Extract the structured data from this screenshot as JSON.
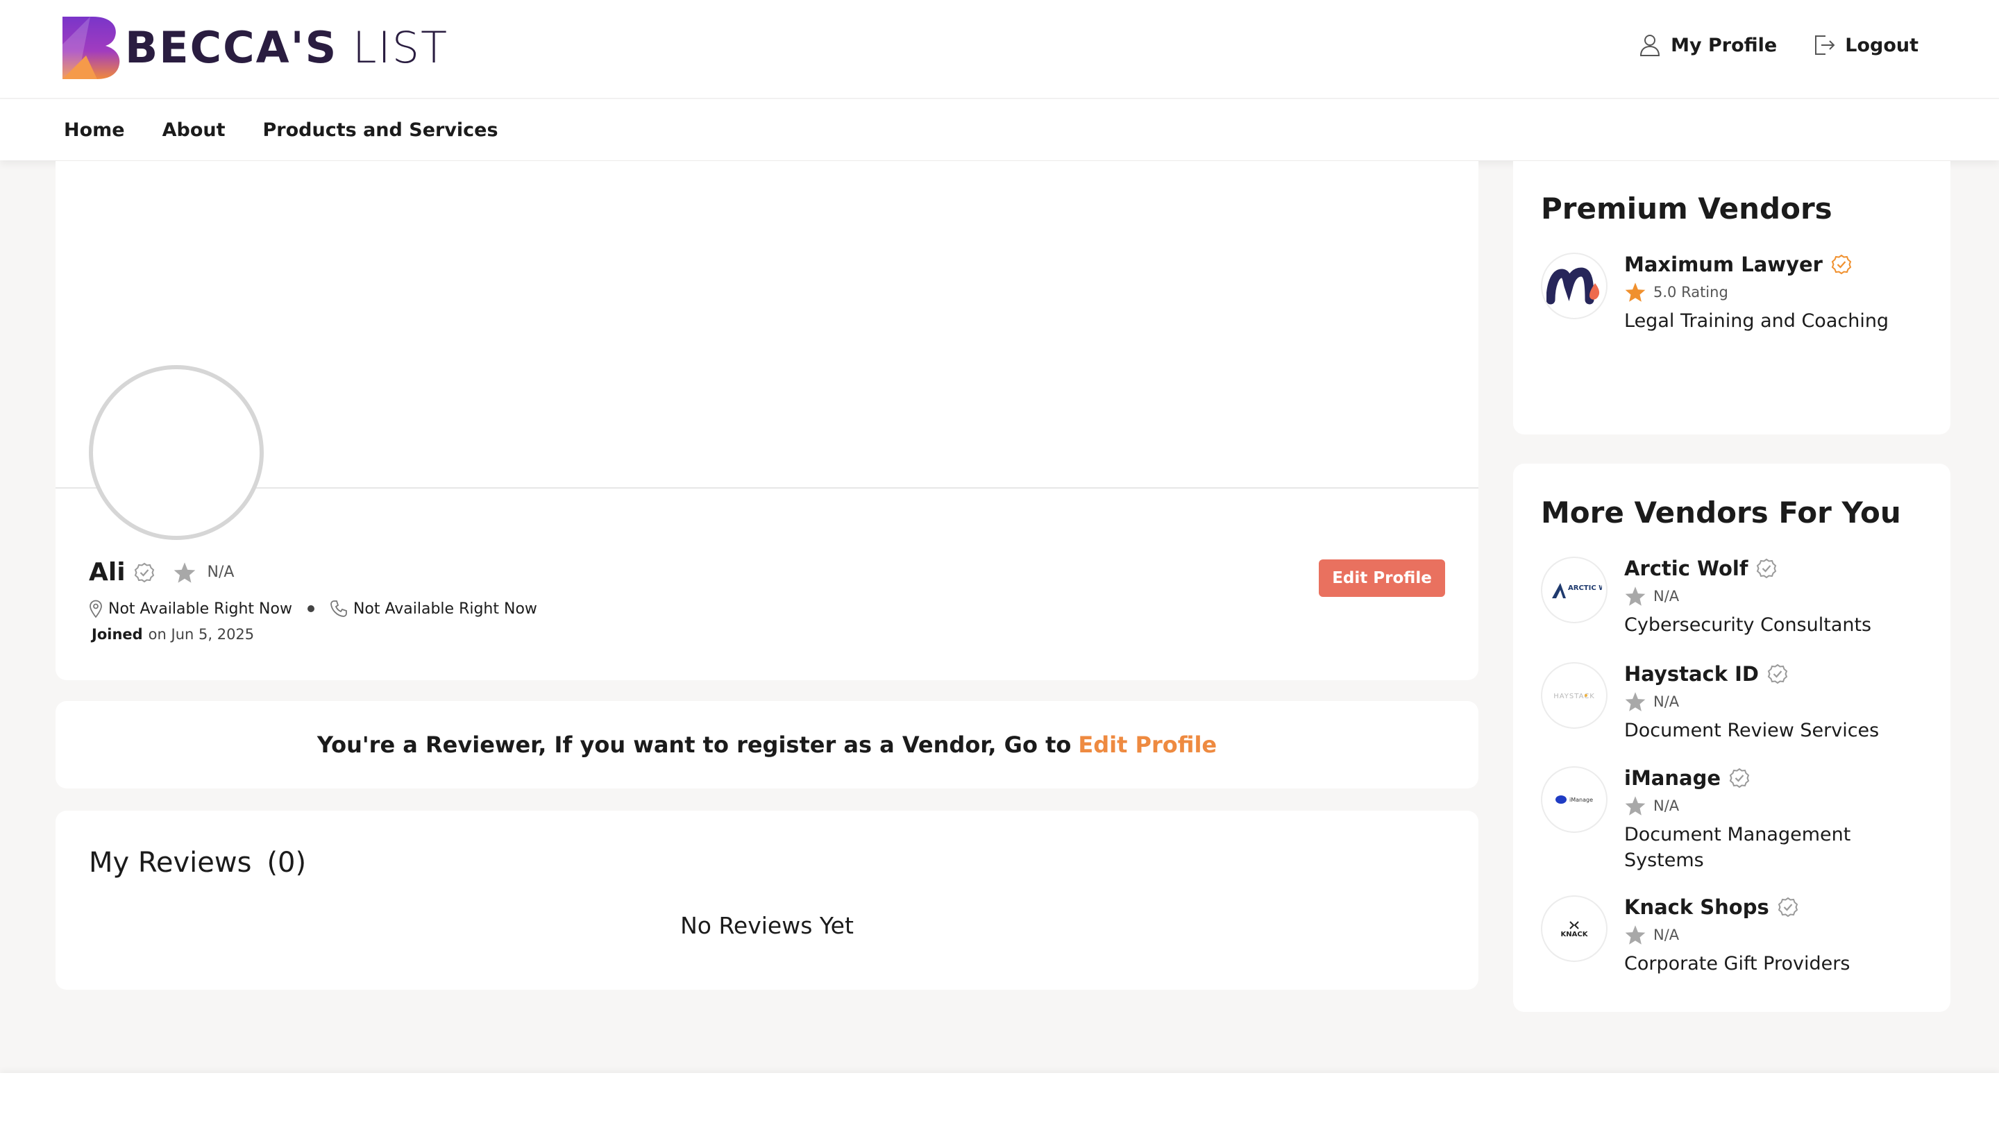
{
  "brand": {
    "name_bold": "BECCA'S",
    "name_light": "LIST",
    "colors": {
      "purple": "#6b2fbf",
      "orange": "#f08a3c",
      "navy": "#2a1d40"
    }
  },
  "header": {
    "my_profile": "My Profile",
    "my_profile_icon": "user-icon",
    "logout": "Logout",
    "logout_icon": "logout-icon"
  },
  "nav": [
    "Home",
    "About",
    "Products and Services"
  ],
  "profile": {
    "name": "Ali",
    "rating": "N/A",
    "location": "Not Available Right Now",
    "phone": "Not Available Right Now",
    "joined_label": "Joined",
    "joined_date": "on Jun 5, 2025",
    "edit_button": "Edit Profile"
  },
  "reviewer_banner": {
    "text": "You're a Reviewer,  If you want to register as a Vendor, Go to",
    "link": "Edit Profile",
    "link_color": "#ee8a40"
  },
  "reviews": {
    "title": "My Reviews",
    "count": "(0)",
    "empty": "No Reviews Yet"
  },
  "premium": {
    "title": "Premium Vendors",
    "vendors": [
      {
        "name": "Maximum Lawyer",
        "rating": "5.0 Rating",
        "category": "Legal Training and Coaching"
      }
    ]
  },
  "more": {
    "title": "More Vendors For You",
    "vendors": [
      {
        "name": "Arctic Wolf",
        "rating": "N/A",
        "category": "Cybersecurity Consultants",
        "logo": "ARCTIC WOLF"
      },
      {
        "name": "Haystack ID",
        "rating": "N/A",
        "category": "Document Review Services",
        "logo": "HAYSTACK"
      },
      {
        "name": "iManage",
        "rating": "N/A",
        "category": "Document Management Systems",
        "logo": "iManage"
      },
      {
        "name": "Knack Shops",
        "rating": "N/A",
        "category": "Corporate Gift Providers",
        "logo": "KNACK"
      }
    ]
  }
}
